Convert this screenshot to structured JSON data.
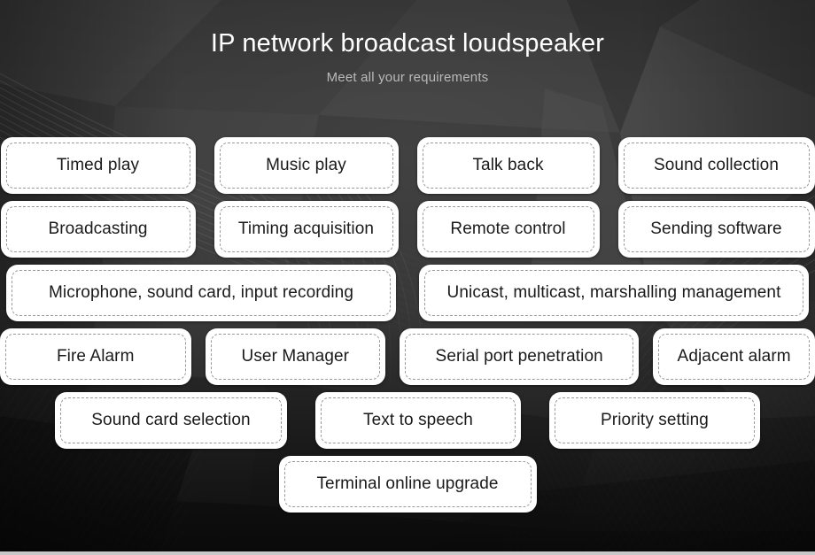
{
  "header": {
    "title": "IP network broadcast loudspeaker",
    "subtitle": "Meet all your requirements"
  },
  "colors": {
    "background_dark": "#3a3a3a",
    "background_darkest": "#1e1e1e",
    "chip_background": "#ffffff",
    "chip_text": "#1a1a1a",
    "chip_dashed_border": "#9a9a9a",
    "title_text": "#ffffff",
    "subtitle_text": "#b9b9b9",
    "bottom_bar": "#c8c8c8"
  },
  "feature_rows": [
    {
      "row": 1,
      "items": [
        {
          "label": "Timed play"
        },
        {
          "label": "Music play"
        },
        {
          "label": "Talk back"
        },
        {
          "label": "Sound collection"
        }
      ]
    },
    {
      "row": 2,
      "items": [
        {
          "label": "Broadcasting"
        },
        {
          "label": "Timing acquisition"
        },
        {
          "label": "Remote control"
        },
        {
          "label": "Sending software"
        }
      ]
    },
    {
      "row": 3,
      "items": [
        {
          "label": "Microphone, sound card, input recording"
        },
        {
          "label": "Unicast, multicast, marshalling management"
        }
      ]
    },
    {
      "row": 4,
      "items": [
        {
          "label": "Fire Alarm"
        },
        {
          "label": "User Manager"
        },
        {
          "label": "Serial port penetration"
        },
        {
          "label": "Adjacent alarm"
        }
      ]
    },
    {
      "row": 5,
      "items": [
        {
          "label": "Sound card selection"
        },
        {
          "label": "Text to speech"
        },
        {
          "label": "Priority setting"
        }
      ]
    },
    {
      "row": 6,
      "items": [
        {
          "label": "Terminal online upgrade"
        }
      ]
    }
  ]
}
